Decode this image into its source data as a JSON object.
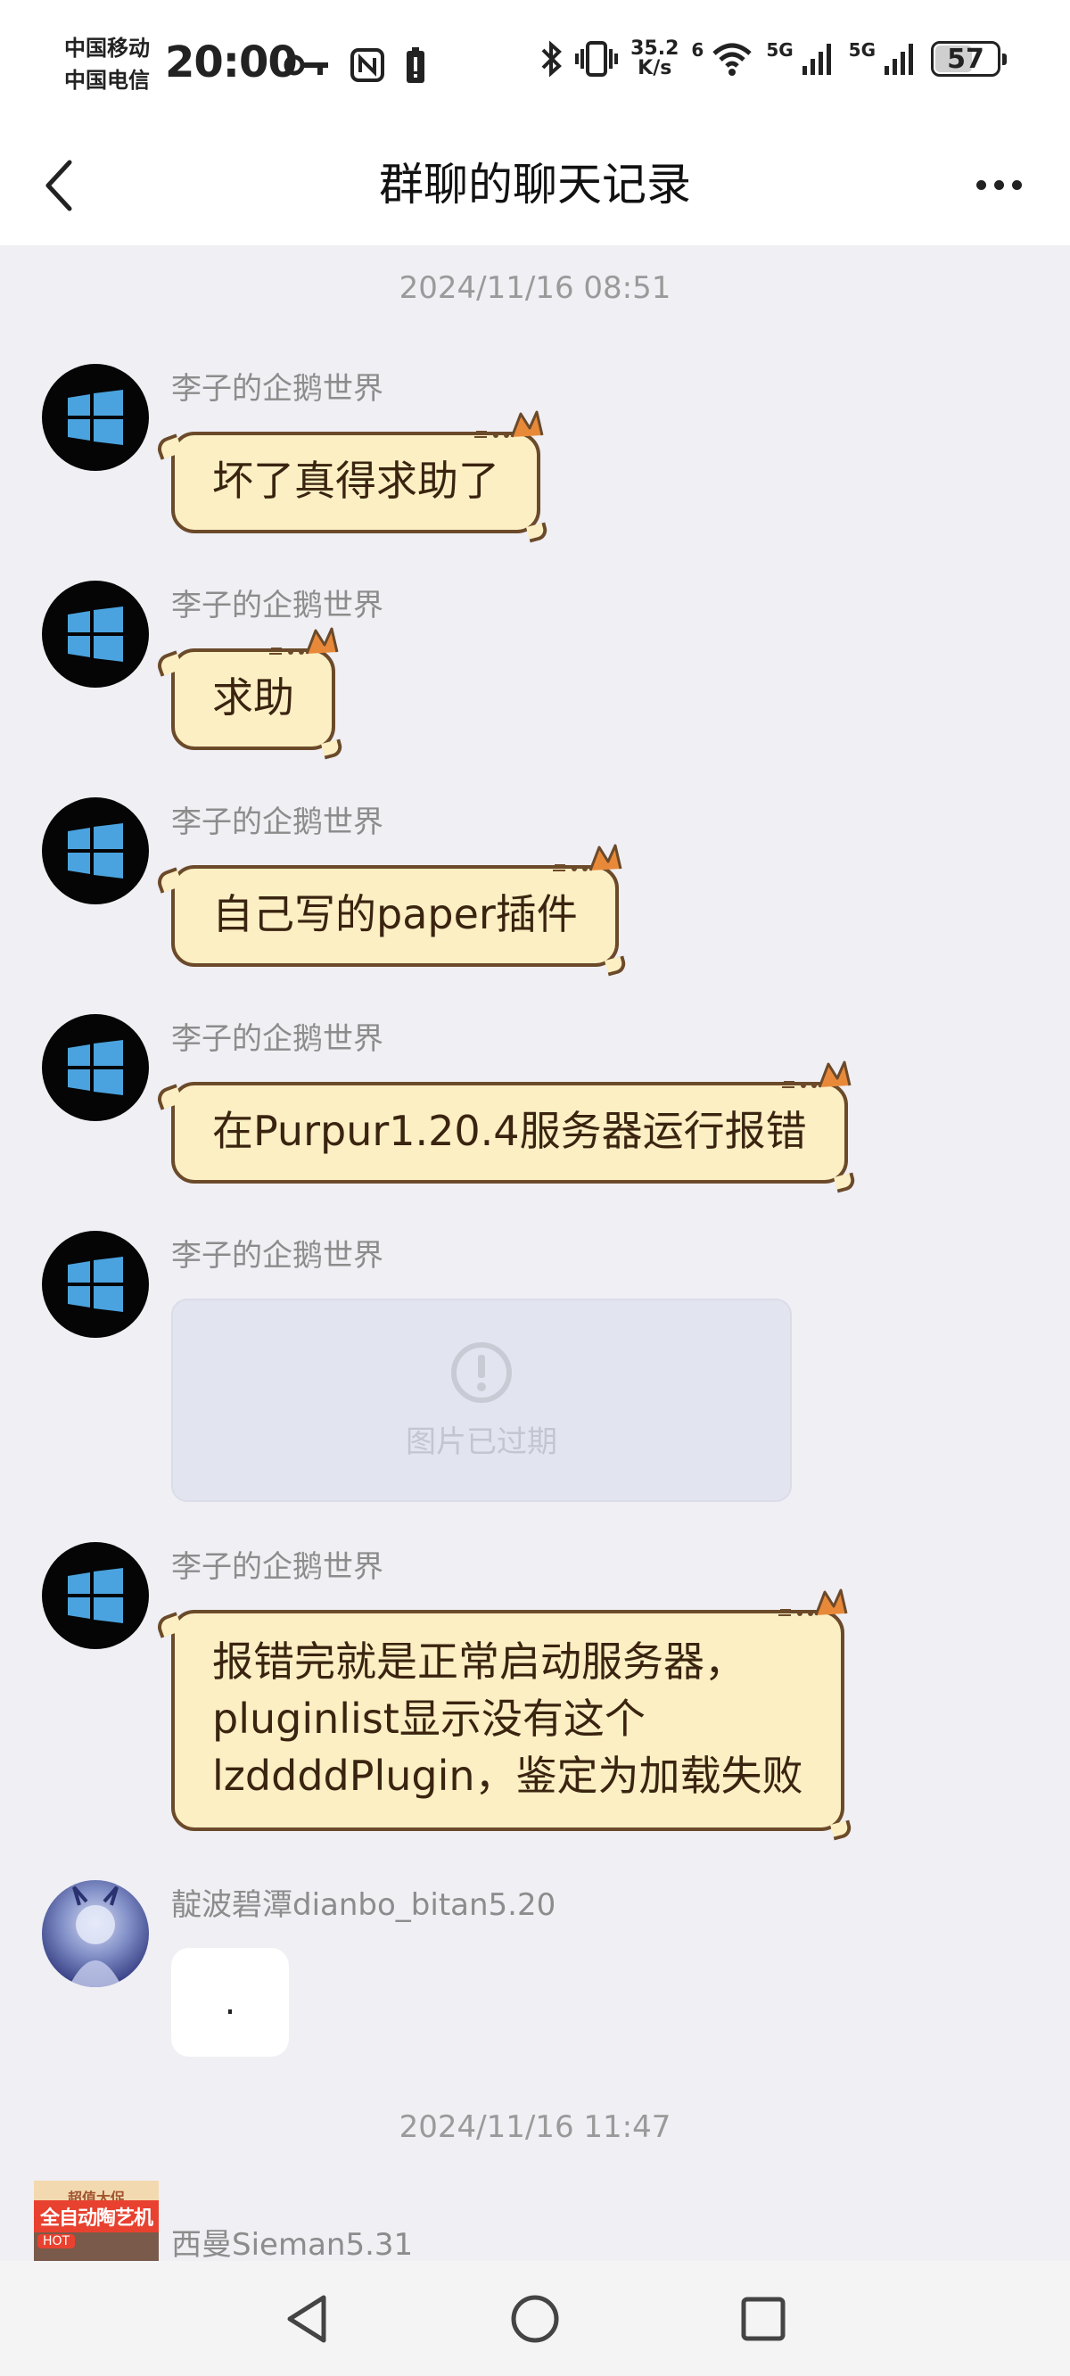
{
  "status_bar": {
    "carrier_1": "中国移动",
    "carrier_2": "中国电信",
    "time": "20:00",
    "net_speed_value": "35.2",
    "net_speed_unit": "K/s",
    "wifi_label": "6",
    "signal_1_label": "5G",
    "signal_2_label": "5G",
    "battery": "57"
  },
  "header": {
    "title": "群聊的聊天记录"
  },
  "chat": {
    "timestamp_1": "2024/11/16 08:51",
    "timestamp_2": "2024/11/16 11:47",
    "messages": [
      {
        "sender": "李子的企鹅世界",
        "text": "坏了真得求助了"
      },
      {
        "sender": "李子的企鹅世界",
        "text": "求助"
      },
      {
        "sender": "李子的企鹅世界",
        "text": "自己写的paper插件"
      },
      {
        "sender": "李子的企鹅世界",
        "text": "在Purpur1.20.4服务器运行报错"
      },
      {
        "sender": "李子的企鹅世界",
        "image_status": "图片已过期"
      },
      {
        "sender": "李子的企鹅世界",
        "lines": [
          "报错完就是正常启动服务器，",
          "pluginlist显示没有这个",
          "lzddddPlugin，鉴定为加载失败"
        ]
      },
      {
        "sender": "靛波碧潭dianbo_bitan5.20",
        "text": "."
      },
      {
        "sender": "西曼Sieman5.31",
        "avatar_text_top": "超值大促",
        "avatar_text_main": "全自动陶艺机",
        "avatar_badge": "HOT"
      }
    ]
  },
  "colors": {
    "bubble_fill": "#fcefc4",
    "bubble_border": "#6b4a2a",
    "background": "#efeff4",
    "windows_blue": "#4aa3df"
  }
}
